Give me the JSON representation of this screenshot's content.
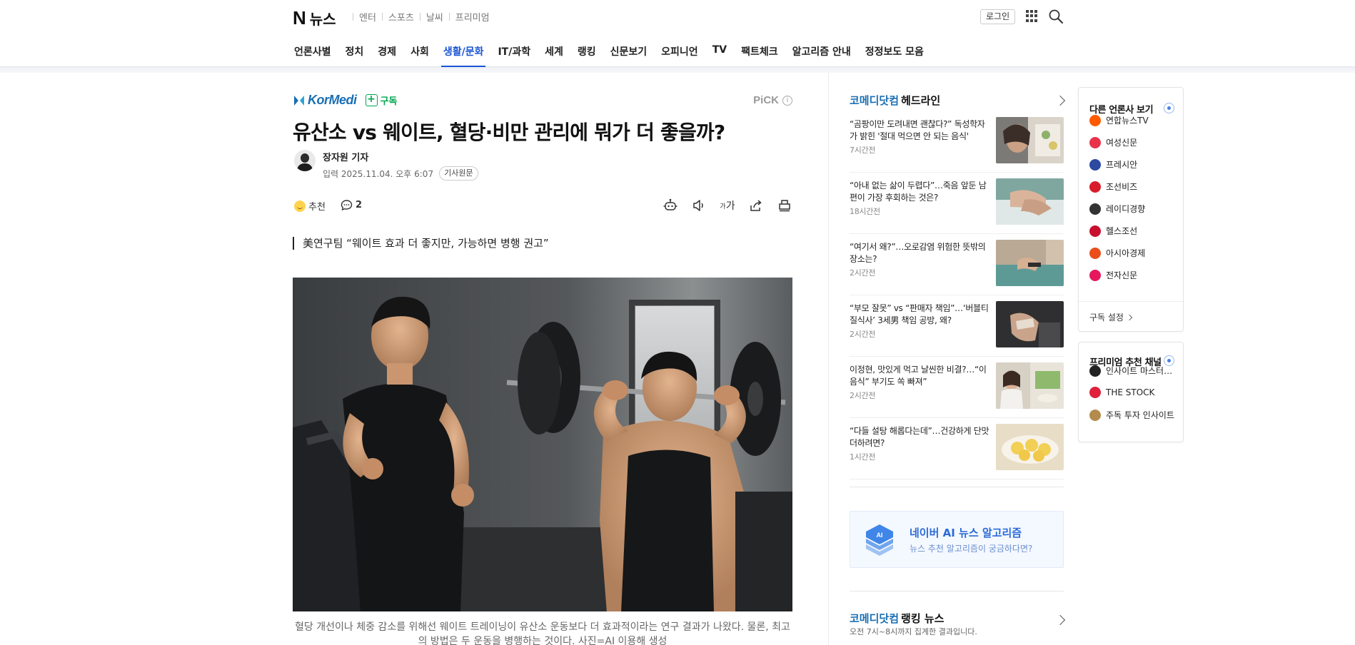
{
  "gnb": {
    "logo_mark": "N",
    "logo_text": "뉴스",
    "services": [
      "엔터",
      "스포츠",
      "날씨",
      "프리미엄"
    ],
    "login_label": "로그인"
  },
  "lnb": {
    "items": [
      "언론사별",
      "정치",
      "경제",
      "사회",
      "생활/문화",
      "IT/과학",
      "세계",
      "랭킹",
      "신문보기",
      "오피니언",
      "TV",
      "팩트체크",
      "알고리즘 안내",
      "정정보도 모음"
    ],
    "active_index": 4
  },
  "article": {
    "press_name": "KorMedi",
    "subscribe_label": "구독",
    "pick_label": "PiCK",
    "pick_info": "i",
    "headline": "유산소 vs 웨이트, 혈당·비만 관리에 뭐가 더 좋을까?",
    "reporter": "장자원 기자",
    "date": "입력 2025.11.04. 오후 6:07",
    "original_label": "기사원문",
    "recommend_label": "추천",
    "comment_count": "2",
    "font_size_label": "가",
    "subtitle": "美연구팀 “웨이트 효과 더 좋지만, 가능하면 병행 권고”",
    "caption": "혈당 개선이나 체중 감소를 위해선 웨이트 트레이닝이 유산소 운동보다 더 효과적이라는 연구 결과가 나왔다. 물론, 최고의 방법은 두 운동을 병행하는 것이다. 사진=AI 이용해 생성"
  },
  "headline_section": {
    "press": "코메디닷컴",
    "title": "헤드라인",
    "items": [
      {
        "text": "“곰팡이만 도려내면 괜찮다?” 독성학자가 밝힌 '절대 먹으면 안 되는 음식'",
        "time": "7시간전"
      },
      {
        "text": "“아내 없는 삶이 두렵다”…죽음 앞둔 남편이 가장 후회하는 것은?",
        "time": "18시간전"
      },
      {
        "text": "“여기서 왜?”…오로감염 위험한 뜻밖의 장소는?",
        "time": "2시간전"
      },
      {
        "text": "“부모 잘못” vs “판매자 책임”…‘버블티 질식사’ 3세男 책임 공방, 왜?",
        "time": "2시간전"
      },
      {
        "text": "이정현, 맛있게 먹고 날씬한 비결?…“이 음식” 부기도 쏙 빠져”",
        "time": "2시간전"
      },
      {
        "text": "“다들 설탕 해롭다는데”…건강하게 단맛 더하려면?",
        "time": "1시간전"
      }
    ]
  },
  "ai_banner": {
    "badge": "AI",
    "title": "네이버 AI 뉴스 알고리즘",
    "subtitle": "뉴스 추천 알고리즘이 궁금하다면?"
  },
  "ranking_section": {
    "press": "코메디닷컴",
    "title": "랭킹 뉴스",
    "subtitle": "오전 7시~8시까지 집계한 결과입니다."
  },
  "other_press": {
    "title": "다른 언론사 보기",
    "items": [
      {
        "name": "연합뉴스TV",
        "color": "#ff5a00"
      },
      {
        "name": "여성신문",
        "color": "#e8334a"
      },
      {
        "name": "프레시안",
        "color": "#2b4aa0"
      },
      {
        "name": "조선비즈",
        "color": "#d91c2b"
      },
      {
        "name": "레이디경향",
        "color": "#333333"
      },
      {
        "name": "헬스조선",
        "color": "#c8102e"
      },
      {
        "name": "아시아경제",
        "color": "#e94e1b"
      },
      {
        "name": "전자신문",
        "color": "#e5185d"
      }
    ],
    "footer": "구독 설정"
  },
  "premium": {
    "title": "프리미엄 추천 채널",
    "items": [
      {
        "name": "인사이트 마스터…",
        "color": "#222222"
      },
      {
        "name": "THE STOCK",
        "color": "#e0203a"
      },
      {
        "name": "주독 투자 인사이트",
        "color": "#b38b4d"
      }
    ]
  },
  "colors": {
    "accent": "#1a55d4",
    "press_blue": "#1a6fb3",
    "subscribe_green": "#00a650"
  }
}
